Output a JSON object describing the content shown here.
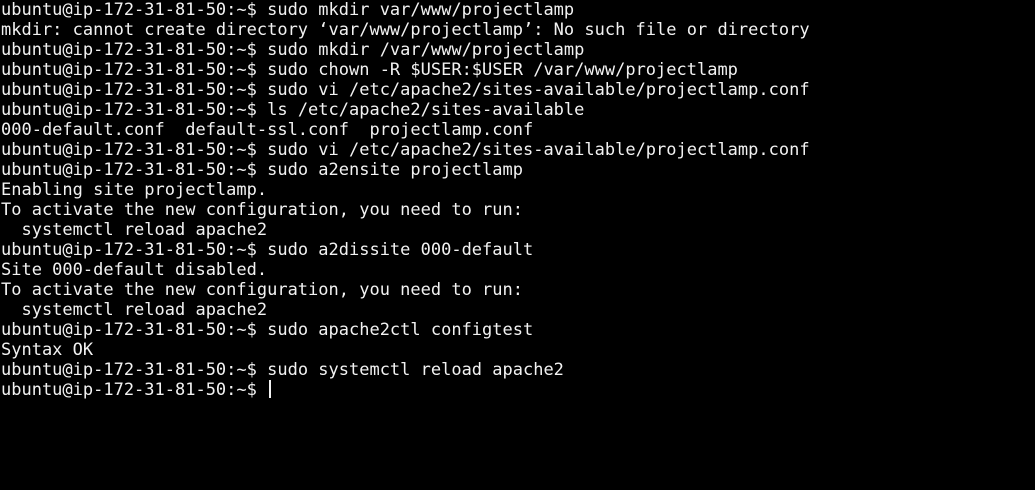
{
  "terminal": {
    "lines": [
      {
        "prompt": "ubuntu@ip-172-31-81-50:~$ ",
        "text": "sudo mkdir var/www/projectlamp"
      },
      {
        "prompt": "",
        "text": "mkdir: cannot create directory ‘var/www/projectlamp’: No such file or directory"
      },
      {
        "prompt": "ubuntu@ip-172-31-81-50:~$ ",
        "text": "sudo mkdir /var/www/projectlamp"
      },
      {
        "prompt": "ubuntu@ip-172-31-81-50:~$ ",
        "text": "sudo chown -R $USER:$USER /var/www/projectlamp"
      },
      {
        "prompt": "ubuntu@ip-172-31-81-50:~$ ",
        "text": "sudo vi /etc/apache2/sites-available/projectlamp.conf"
      },
      {
        "prompt": "ubuntu@ip-172-31-81-50:~$ ",
        "text": "ls /etc/apache2/sites-available"
      },
      {
        "prompt": "",
        "text": "000-default.conf  default-ssl.conf  projectlamp.conf"
      },
      {
        "prompt": "ubuntu@ip-172-31-81-50:~$ ",
        "text": "sudo vi /etc/apache2/sites-available/projectlamp.conf"
      },
      {
        "prompt": "ubuntu@ip-172-31-81-50:~$ ",
        "text": "sudo a2ensite projectlamp"
      },
      {
        "prompt": "",
        "text": "Enabling site projectlamp."
      },
      {
        "prompt": "",
        "text": "To activate the new configuration, you need to run:"
      },
      {
        "prompt": "",
        "text": "  systemctl reload apache2"
      },
      {
        "prompt": "ubuntu@ip-172-31-81-50:~$ ",
        "text": "sudo a2dissite 000-default"
      },
      {
        "prompt": "",
        "text": "Site 000-default disabled."
      },
      {
        "prompt": "",
        "text": "To activate the new configuration, you need to run:"
      },
      {
        "prompt": "",
        "text": "  systemctl reload apache2"
      },
      {
        "prompt": "ubuntu@ip-172-31-81-50:~$ ",
        "text": "sudo apache2ctl configtest"
      },
      {
        "prompt": "",
        "text": "Syntax OK"
      },
      {
        "prompt": "ubuntu@ip-172-31-81-50:~$ ",
        "text": "sudo systemctl reload apache2"
      },
      {
        "prompt": "ubuntu@ip-172-31-81-50:~$ ",
        "text": "",
        "cursor": true
      }
    ]
  },
  "colors": {
    "background": "#000000",
    "foreground": "#f2f2f2"
  }
}
